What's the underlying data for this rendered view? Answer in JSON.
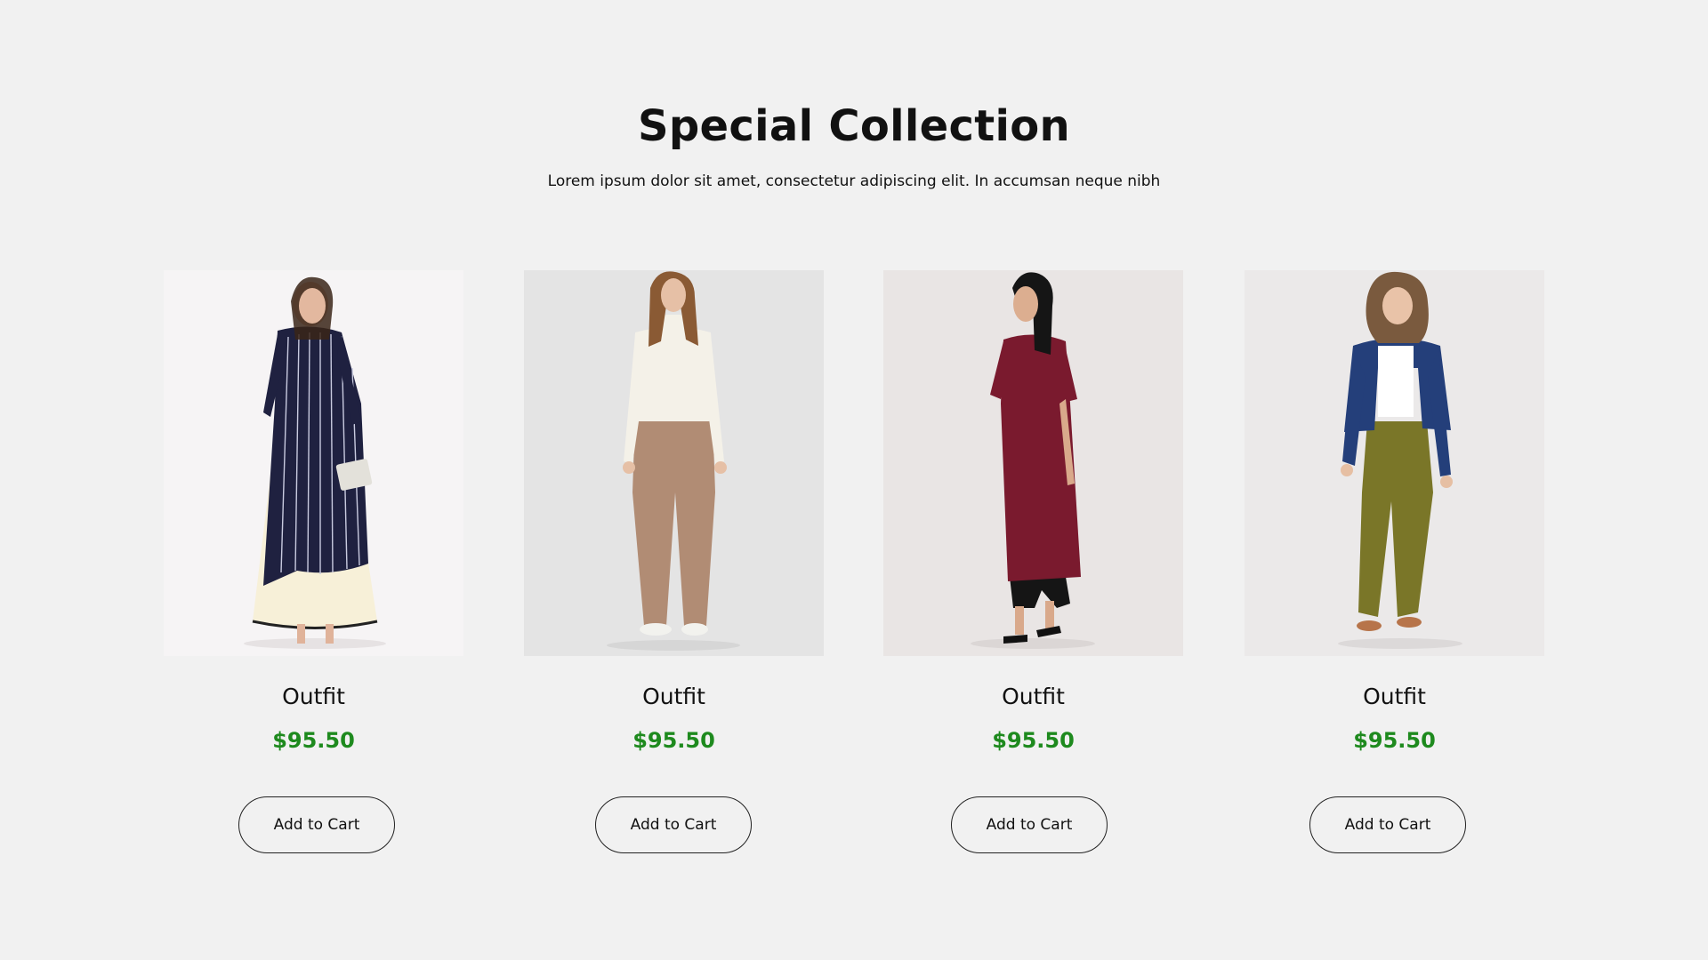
{
  "section": {
    "title": "Special Collection",
    "subtitle": "Lorem ipsum dolor sit amet, consectetur adipiscing elit. In accumsan neque nibh"
  },
  "products": [
    {
      "name": "Outfit",
      "price": "$95.50",
      "button_label": "Add to Cart",
      "image": "woman-striped-navy-kurta-photo"
    },
    {
      "name": "Outfit",
      "price": "$95.50",
      "button_label": "Add to Cart",
      "image": "woman-white-turtleneck-brown-trousers-photo"
    },
    {
      "name": "Outfit",
      "price": "$95.50",
      "button_label": "Add to Cart",
      "image": "woman-maroon-kurta-photo"
    },
    {
      "name": "Outfit",
      "price": "$95.50",
      "button_label": "Add to Cart",
      "image": "woman-denim-jacket-olive-pants-photo"
    }
  ],
  "colors": {
    "background": "#f1f1f1",
    "price": "#1e8a1e",
    "text": "#111111"
  }
}
